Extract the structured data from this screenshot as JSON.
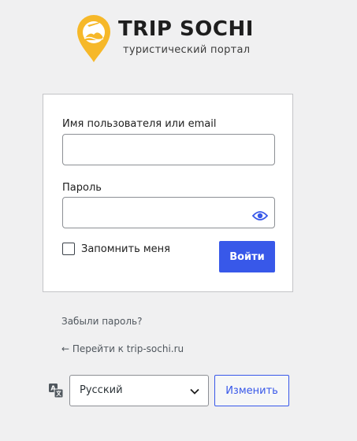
{
  "logo": {
    "title": "TRIP SOCHI",
    "subtitle": "туристический портал",
    "pin_color": "#f6b829"
  },
  "login_form": {
    "username_label": "Имя пользователя или email",
    "username_value": "",
    "password_label": "Пароль",
    "password_value": "",
    "remember_label": "Запомнить меня",
    "remember_checked": false,
    "submit_label": "Войти"
  },
  "links": {
    "lost_password": "Забыли пароль?",
    "back_to_site": "← Перейти к trip-sochi.ru"
  },
  "language": {
    "selected": "Русский",
    "change_label": "Изменить"
  },
  "colors": {
    "accent": "#3858e9",
    "background": "#f0f0f1"
  }
}
